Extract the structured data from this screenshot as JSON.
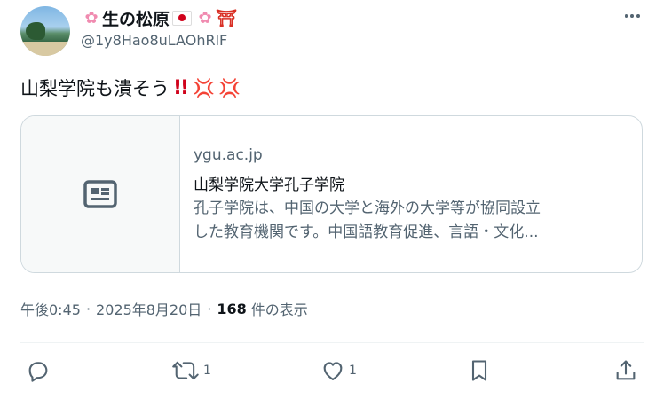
{
  "author": {
    "display_name": "生の松原",
    "handle": "@1y8Hao8uLAOhRlF",
    "name_emojis": [
      "cherry-blossom",
      "japan-flag",
      "cherry-blossom",
      "torii-gate"
    ]
  },
  "tweet": {
    "text": "山梨学院も潰そう",
    "emojis": [
      "double-exclamation",
      "anger-symbol",
      "anger-symbol"
    ]
  },
  "card": {
    "domain": "ygu.ac.jp",
    "title": "山梨学院大学孔子学院",
    "description_lines": [
      "孔子学院は、中国の大学と海外の大学等が協同設立",
      "した教育機関です。中国語教育促進、言語・文化..."
    ]
  },
  "meta": {
    "time": "午後0:45",
    "separator": "·",
    "date": "2025年8月20日",
    "views_count": "168",
    "views_label": "件の表示"
  },
  "actions": {
    "reply_count": "",
    "retweet_count": "1",
    "like_count": "1"
  },
  "colors": {
    "text_primary": "#0f1419",
    "text_secondary": "#536471",
    "border": "#cfd9de"
  }
}
